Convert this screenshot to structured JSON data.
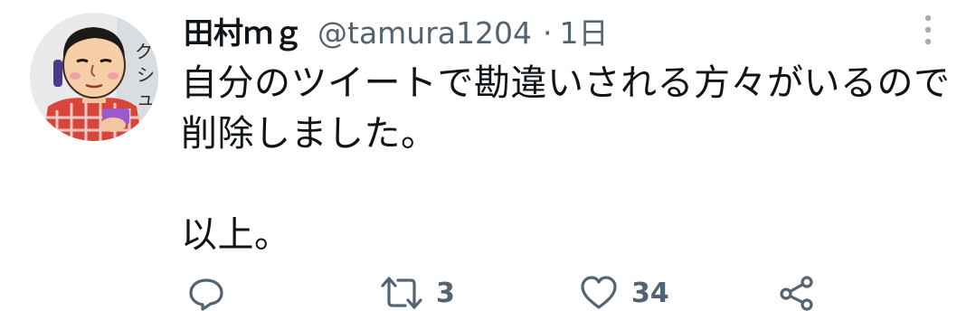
{
  "tweet": {
    "display_name": "田村ｍｇ",
    "handle": "@tamura1204",
    "separator": "·",
    "time": "1日",
    "text": "自分のツイートで勘違いされる方々がいるので\n削除しました。\n\n以上。",
    "actions": {
      "reply_count": "",
      "retweet_count": "3",
      "like_count": "34"
    },
    "icons": {
      "more": "more-vertical-icon",
      "reply": "reply-icon",
      "retweet": "retweet-icon",
      "like": "heart-icon",
      "share": "share-icon"
    },
    "colors": {
      "primary_text": "#0f1419",
      "secondary_text": "#536471"
    }
  }
}
